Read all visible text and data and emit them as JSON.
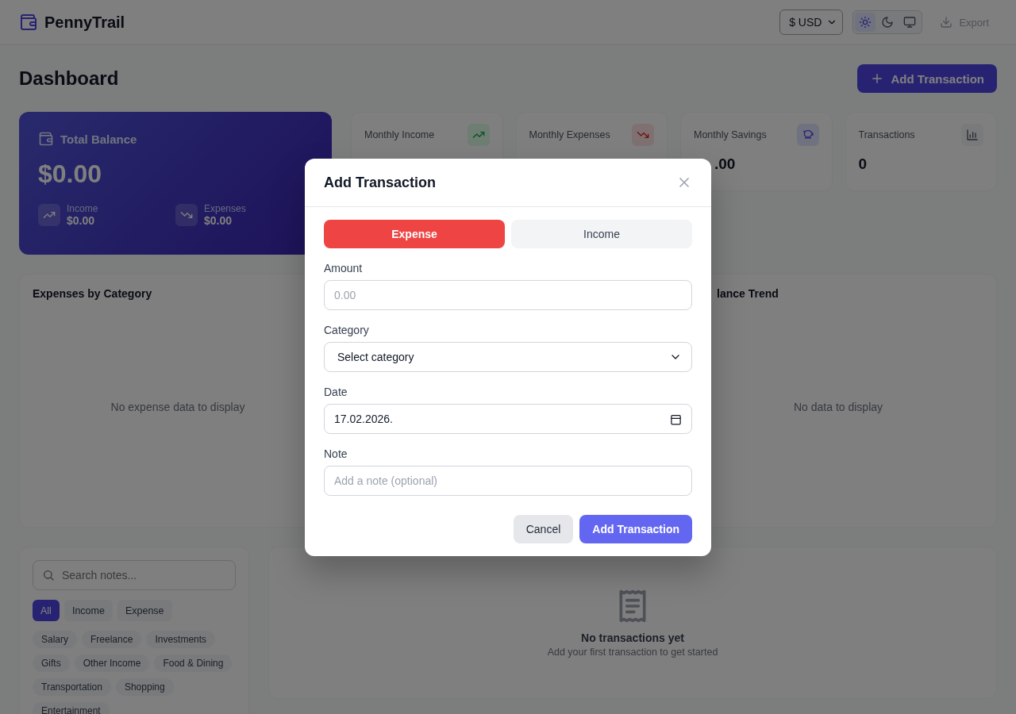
{
  "header": {
    "logo": "PennyTrail",
    "currency": "$ USD",
    "theme_options": [
      {
        "kind": "light",
        "selected": true
      },
      {
        "kind": "dark",
        "selected": false
      },
      {
        "kind": "system",
        "selected": false
      }
    ],
    "export": {
      "label": "Export",
      "disabled": true
    }
  },
  "page": {
    "title": "Dashboard",
    "add_button": "Add Transaction"
  },
  "balance_card": {
    "title": "Total Balance",
    "amount": "$0.00",
    "items": [
      {
        "kind": "income",
        "label": "Income",
        "value": "$0.00"
      },
      {
        "kind": "expense",
        "label": "Expenses",
        "value": "$0.00"
      }
    ]
  },
  "stat_cards": [
    {
      "kind": "income",
      "label": "Monthly Income"
    },
    {
      "kind": "expense",
      "label": "Monthly Expenses"
    },
    {
      "kind": "savings",
      "label": "Monthly Savings",
      "value": ".00"
    },
    {
      "kind": "count",
      "label": "Transactions",
      "value": "0"
    }
  ],
  "charts": [
    {
      "title": "Expenses by Category",
      "empty_text": "No expense data to display"
    },
    {
      "title": "lance Trend",
      "empty_text": "No data to display"
    }
  ],
  "filters": {
    "search_placeholder": "Search notes...",
    "types": [
      {
        "label": "All",
        "selected": true
      },
      {
        "label": "Income",
        "selected": false
      },
      {
        "label": "Expense",
        "selected": false
      }
    ],
    "categories": [
      {
        "label": "Salary",
        "selected": false
      },
      {
        "label": "Freelance",
        "selected": false
      },
      {
        "label": "Investments",
        "selected": false
      },
      {
        "label": "Gifts",
        "selected": false
      },
      {
        "label": "Other Income",
        "selected": false
      },
      {
        "label": "Food & Dining",
        "selected": false
      },
      {
        "label": "Transportation",
        "selected": false
      },
      {
        "label": "Shopping",
        "selected": false
      },
      {
        "label": "Entertainment",
        "selected": false
      }
    ]
  },
  "transactions": {
    "empty_title": "No transactions yet",
    "empty_text": "Add your first transaction to get started"
  },
  "modal": {
    "title": "Add Transaction",
    "type_toggle": [
      {
        "kind": "expense",
        "label": "Expense",
        "selected": true
      },
      {
        "kind": "income",
        "label": "Income",
        "selected": false
      }
    ],
    "fields": [
      {
        "kind": "number",
        "label": "Amount",
        "placeholder": "0.00"
      },
      {
        "kind": "select",
        "label": "Category",
        "value": "Select category"
      },
      {
        "kind": "date",
        "label": "Date",
        "value": "17.02.2026."
      },
      {
        "kind": "text",
        "label": "Note",
        "placeholder": "Add a note (optional)"
      }
    ],
    "buttons": [
      {
        "kind": "secondary",
        "label": "Cancel"
      },
      {
        "kind": "primary",
        "label": "Add Transaction"
      }
    ]
  }
}
